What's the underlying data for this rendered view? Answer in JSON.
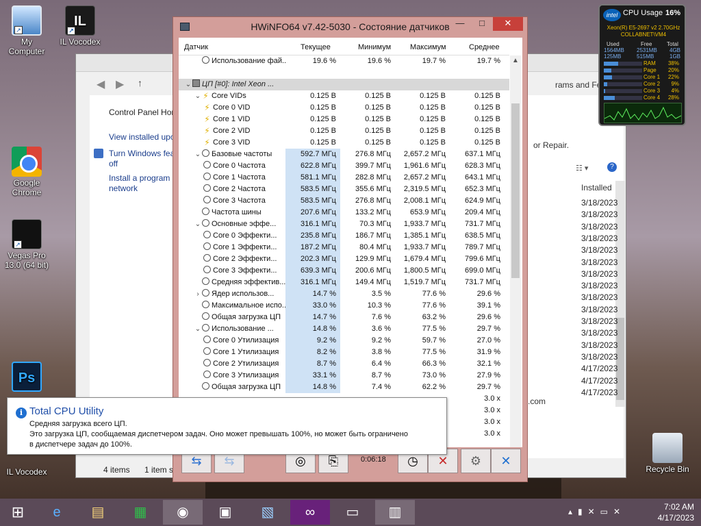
{
  "desktop": {
    "icons": [
      {
        "label": "My Computer"
      },
      {
        "label": "IL Vocodex"
      },
      {
        "label": "Google Chrome"
      },
      {
        "label": "Vegas Pro 13.0 (64 bit)"
      },
      {
        "label": "IL Vocodex"
      },
      {
        "label": "Recycle Bin"
      }
    ]
  },
  "control_panel": {
    "sidebar": [
      "Control Panel Hor",
      "View installed upc",
      "Turn Windows fea off",
      "Install a program network"
    ],
    "header_right": "rams and Features",
    "repair_text": "or Repair.",
    "col_installed": "Installed",
    "dates": [
      "3/18/2023",
      "3/18/2023",
      "3/18/2023",
      "3/18/2023",
      "3/18/2023",
      "3/18/2023",
      "3/18/2023",
      "3/18/2023",
      "3/18/2023",
      "3/18/2023",
      "3/18/2023",
      "3/18/2023",
      "3/18/2023",
      "3/18/2023",
      "4/17/2023",
      "4/17/2023",
      "4/17/2023"
    ],
    "com_text": ".com",
    "status": {
      "items": "4 items",
      "selected": "1 item s"
    }
  },
  "hwinfo": {
    "title": "HWiNFO64 v7.42-5030 - Состояние датчиков",
    "columns": {
      "name": "Датчик",
      "cur": "Текущее",
      "min": "Минимум",
      "max": "Максимум",
      "avg": "Среднее"
    },
    "rows": [
      {
        "name": "Использование фай...",
        "cur": "19.6 %",
        "min": "19.6 %",
        "max": "19.7 %",
        "avg": "19.7 %",
        "icon": "clock",
        "indent": 1,
        "exp": ""
      },
      {
        "name": "",
        "cur": "",
        "min": "",
        "max": "",
        "avg": "",
        "icon": "",
        "indent": 0,
        "exp": ""
      },
      {
        "name": "ЦП [#0]: Intel Xeon ...",
        "cur": "",
        "min": "",
        "max": "",
        "avg": "",
        "icon": "chip",
        "indent": 0,
        "exp": "v",
        "section": true
      },
      {
        "name": "Core VIDs",
        "cur": "0.125 В",
        "min": "0.125 В",
        "max": "0.125 В",
        "avg": "0.125 В",
        "icon": "bolt",
        "indent": 1,
        "exp": "v"
      },
      {
        "name": "Core 0 VID",
        "cur": "0.125 В",
        "min": "0.125 В",
        "max": "0.125 В",
        "avg": "0.125 В",
        "icon": "bolt",
        "indent": 2,
        "exp": ""
      },
      {
        "name": "Core 1 VID",
        "cur": "0.125 В",
        "min": "0.125 В",
        "max": "0.125 В",
        "avg": "0.125 В",
        "icon": "bolt",
        "indent": 2,
        "exp": ""
      },
      {
        "name": "Core 2 VID",
        "cur": "0.125 В",
        "min": "0.125 В",
        "max": "0.125 В",
        "avg": "0.125 В",
        "icon": "bolt",
        "indent": 2,
        "exp": ""
      },
      {
        "name": "Core 3 VID",
        "cur": "0.125 В",
        "min": "0.125 В",
        "max": "0.125 В",
        "avg": "0.125 В",
        "icon": "bolt",
        "indent": 2,
        "exp": ""
      },
      {
        "name": "Базовые частоты",
        "cur": "592.7 МГц",
        "min": "276.8 МГц",
        "max": "2,657.2 МГц",
        "avg": "637.1 МГц",
        "icon": "clock",
        "indent": 1,
        "exp": "v",
        "hl": true
      },
      {
        "name": "Core 0 Частота",
        "cur": "622.8 МГц",
        "min": "399.7 МГц",
        "max": "1,961.6 МГц",
        "avg": "628.3 МГц",
        "icon": "clock",
        "indent": 2,
        "exp": "",
        "hl": true
      },
      {
        "name": "Core 1 Частота",
        "cur": "581.1 МГц",
        "min": "282.8 МГц",
        "max": "2,657.2 МГц",
        "avg": "643.1 МГц",
        "icon": "clock",
        "indent": 2,
        "exp": "",
        "hl": true
      },
      {
        "name": "Core 2 Частота",
        "cur": "583.5 МГц",
        "min": "355.6 МГц",
        "max": "2,319.5 МГц",
        "avg": "652.3 МГц",
        "icon": "clock",
        "indent": 2,
        "exp": "",
        "hl": true
      },
      {
        "name": "Core 3 Частота",
        "cur": "583.5 МГц",
        "min": "276.8 МГц",
        "max": "2,008.1 МГц",
        "avg": "624.9 МГц",
        "icon": "clock",
        "indent": 2,
        "exp": "",
        "hl": true
      },
      {
        "name": "Частота шины",
        "cur": "207.6 МГц",
        "min": "133.2 МГц",
        "max": "653.9 МГц",
        "avg": "209.4 МГц",
        "icon": "clock",
        "indent": 1,
        "exp": "",
        "hl": true
      },
      {
        "name": "Основные эффе...",
        "cur": "316.1 МГц",
        "min": "70.3 МГц",
        "max": "1,933.7 МГц",
        "avg": "731.7 МГц",
        "icon": "clock",
        "indent": 1,
        "exp": "v",
        "hl": true
      },
      {
        "name": "Core 0 Эффекти...",
        "cur": "235.8 МГц",
        "min": "186.7 МГц",
        "max": "1,385.1 МГц",
        "avg": "638.5 МГц",
        "icon": "clock",
        "indent": 2,
        "exp": "",
        "hl": true
      },
      {
        "name": "Core 1 Эффекти...",
        "cur": "187.2 МГц",
        "min": "80.4 МГц",
        "max": "1,933.7 МГц",
        "avg": "789.7 МГц",
        "icon": "clock",
        "indent": 2,
        "exp": "",
        "hl": true
      },
      {
        "name": "Core 2 Эффекти...",
        "cur": "202.3 МГц",
        "min": "129.9 МГц",
        "max": "1,679.4 МГц",
        "avg": "799.6 МГц",
        "icon": "clock",
        "indent": 2,
        "exp": "",
        "hl": true
      },
      {
        "name": "Core 3 Эффекти...",
        "cur": "639.3 МГц",
        "min": "200.6 МГц",
        "max": "1,800.5 МГц",
        "avg": "699.0 МГц",
        "icon": "clock",
        "indent": 2,
        "exp": "",
        "hl": true
      },
      {
        "name": "Средняя эффектив...",
        "cur": "316.1 МГц",
        "min": "149.4 МГц",
        "max": "1,519.7 МГц",
        "avg": "731.7 МГц",
        "icon": "clock",
        "indent": 1,
        "exp": "",
        "hl": true
      },
      {
        "name": "Ядер использов...",
        "cur": "14.7 %",
        "min": "3.5 %",
        "max": "77.6 %",
        "avg": "29.6 %",
        "icon": "clock",
        "indent": 1,
        "exp": ">",
        "hl": true
      },
      {
        "name": "Максимальное испо...",
        "cur": "33.0 %",
        "min": "10.3 %",
        "max": "77.6 %",
        "avg": "39.1 %",
        "icon": "clock",
        "indent": 1,
        "exp": "",
        "hl": true
      },
      {
        "name": "Общая загрузка ЦП",
        "cur": "14.7 %",
        "min": "7.6 %",
        "max": "63.2 %",
        "avg": "29.6 %",
        "icon": "clock",
        "indent": 1,
        "exp": "",
        "hl": true
      },
      {
        "name": "Использование ...",
        "cur": "14.8 %",
        "min": "3.6 %",
        "max": "77.5 %",
        "avg": "29.7 %",
        "icon": "clock",
        "indent": 1,
        "exp": "v",
        "hl": true
      },
      {
        "name": "Core 0 Утилизация",
        "cur": "9.2 %",
        "min": "9.2 %",
        "max": "59.7 %",
        "avg": "27.0 %",
        "icon": "clock",
        "indent": 2,
        "exp": "",
        "hl": true
      },
      {
        "name": "Core 1 Утилизация",
        "cur": "8.2 %",
        "min": "3.8 %",
        "max": "77.5 %",
        "avg": "31.9 %",
        "icon": "clock",
        "indent": 2,
        "exp": "",
        "hl": true
      },
      {
        "name": "Core 2 Утилизация",
        "cur": "8.7 %",
        "min": "6.4 %",
        "max": "66.3 %",
        "avg": "32.1 %",
        "icon": "clock",
        "indent": 2,
        "exp": "",
        "hl": true
      },
      {
        "name": "Core 3 Утилизация",
        "cur": "33.1 %",
        "min": "8.7 %",
        "max": "73.0 %",
        "avg": "27.9 %",
        "icon": "clock",
        "indent": 2,
        "exp": "",
        "hl": true
      },
      {
        "name": "Общая загрузка ЦП",
        "cur": "14.8 %",
        "min": "7.4 %",
        "max": "62.2 %",
        "avg": "29.7 %",
        "icon": "clock",
        "indent": 1,
        "exp": "",
        "hl": true
      },
      {
        "name": "",
        "cur": "",
        "min": "",
        "max": "",
        "avg": "3.0 x",
        "icon": "",
        "indent": 0,
        "exp": ""
      },
      {
        "name": "",
        "cur": "",
        "min": "",
        "max": "",
        "avg": "3.0 x",
        "icon": "",
        "indent": 0,
        "exp": ""
      },
      {
        "name": "",
        "cur": "",
        "min": "",
        "max": "",
        "avg": "3.0 x",
        "icon": "",
        "indent": 0,
        "exp": ""
      },
      {
        "name": "",
        "cur": "",
        "min": "",
        "max": "",
        "avg": "3.0 x",
        "icon": "",
        "indent": 0,
        "exp": ""
      }
    ],
    "timer": "0:06:18"
  },
  "tooltip": {
    "title": "Total CPU Utility",
    "line1": "Средняя загрузка всего ЦП.",
    "line2": "Это загрузка ЦП, сообщаемая диспетчером задач. Оно может превышать 100%, но может быть ограничено",
    "line3": "в диспетчере задач до 100%."
  },
  "gadget": {
    "logo": "intel",
    "title": "CPU Usage",
    "percent": "16%",
    "cpu_line1": "Xeon(R) E5-2697 v2 2.70GHz",
    "cpu_line2": "COLLABNET\\VM4",
    "mem_headers": [
      "Used",
      "Free",
      "Total"
    ],
    "mem_row1": [
      "1564MB",
      "2531MB",
      "4GB"
    ],
    "mem_row2": [
      "125MB",
      "515MB",
      "1GB"
    ],
    "bars": [
      {
        "label": "RAM",
        "value": "38%",
        "fill": 0.38
      },
      {
        "label": "Page",
        "value": "20%",
        "fill": 0.2
      },
      {
        "label": "Core 1",
        "value": "22%",
        "fill": 0.22
      },
      {
        "label": "Core 2",
        "value": "9%",
        "fill": 0.09
      },
      {
        "label": "Core 3",
        "value": "4%",
        "fill": 0.04
      },
      {
        "label": "Core 4",
        "value": "28%",
        "fill": 0.28
      }
    ]
  },
  "taskbar": {
    "time": "7:02 AM",
    "date": "4/17/2023"
  }
}
